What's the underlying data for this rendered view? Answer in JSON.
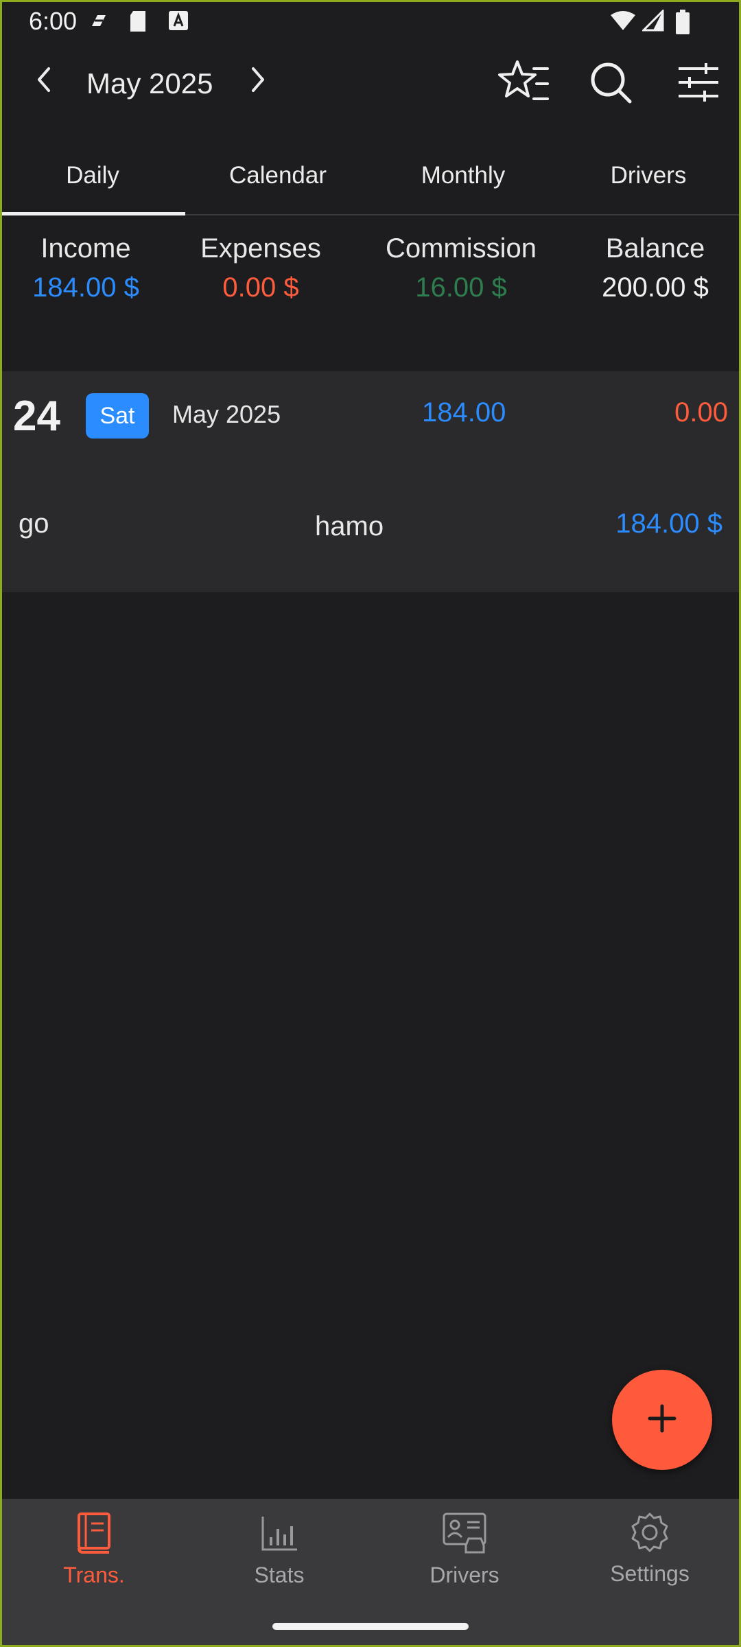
{
  "status_bar": {
    "time": "6:00"
  },
  "header": {
    "month_title": "May 2025",
    "icons": [
      "chevron-left-icon",
      "chevron-right-icon",
      "star-list-icon",
      "search-icon",
      "filter-sliders-icon"
    ]
  },
  "tabs": [
    {
      "label": "Daily",
      "active": true
    },
    {
      "label": "Calendar",
      "active": false
    },
    {
      "label": "Monthly",
      "active": false
    },
    {
      "label": "Drivers",
      "active": false
    }
  ],
  "summary": {
    "income": {
      "label": "Income",
      "value": "184.00 $"
    },
    "expenses": {
      "label": "Expenses",
      "value": "0.00 $"
    },
    "commission": {
      "label": "Commission",
      "value": "16.00 $"
    },
    "balance": {
      "label": "Balance",
      "value": "200.00 $"
    }
  },
  "day_group": {
    "day": "24",
    "weekday": "Sat",
    "month": "May 2025",
    "income": "184.00",
    "expense": "0.00",
    "transactions": [
      {
        "category": "go",
        "note": "hamo",
        "amount": "184.00 $"
      }
    ]
  },
  "fab": {
    "icon": "plus-icon"
  },
  "bottom_nav": [
    {
      "label": "Trans.",
      "icon": "book-icon",
      "active": true
    },
    {
      "label": "Stats",
      "icon": "bar-chart-icon",
      "active": false
    },
    {
      "label": "Drivers",
      "icon": "driver-id-card-icon",
      "active": false
    },
    {
      "label": "Settings",
      "icon": "gear-icon",
      "active": false
    }
  ],
  "colors": {
    "background": "#1d1d1f",
    "income_blue": "#2a8cff",
    "expense_red": "#ff5c3d",
    "commission_green": "#2e7d4f",
    "accent_orange": "#ff5a3c"
  }
}
